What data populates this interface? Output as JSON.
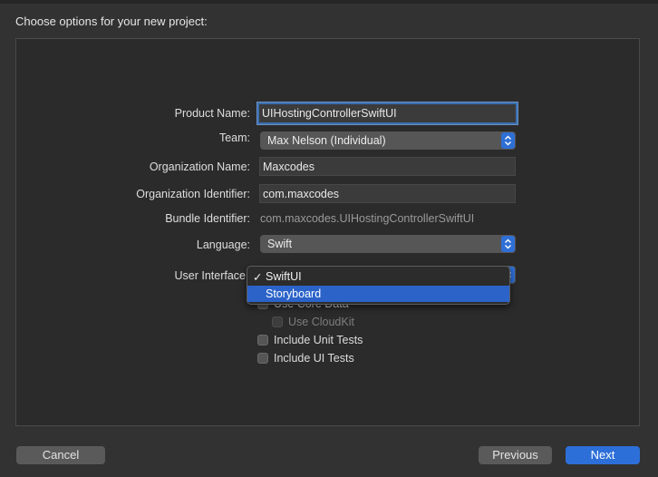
{
  "header": {
    "title": "Choose options for your new project:"
  },
  "form": {
    "product_name": {
      "label": "Product Name:",
      "value": "UIHostingControllerSwiftUI"
    },
    "team": {
      "label": "Team:",
      "value": "Max Nelson (Individual)"
    },
    "organization_name": {
      "label": "Organization Name:",
      "value": "Maxcodes"
    },
    "organization_identifier": {
      "label": "Organization Identifier:",
      "value": "com.maxcodes"
    },
    "bundle_identifier": {
      "label": "Bundle Identifier:",
      "value": "com.maxcodes.UIHostingControllerSwiftUI"
    },
    "language": {
      "label": "Language:",
      "value": "Swift"
    },
    "user_interface": {
      "label": "User Interface",
      "menu": [
        {
          "label": "SwiftUI",
          "checked": true,
          "check_mark": "✓"
        },
        {
          "label": "Storyboard",
          "highlighted": true
        }
      ]
    },
    "checkboxes": [
      {
        "label": "Use Core Data",
        "checked": false
      },
      {
        "label": "Use CloudKit",
        "checked": false,
        "disabled": true
      },
      {
        "label": "Include Unit Tests",
        "checked": false
      },
      {
        "label": "Include UI Tests",
        "checked": false
      }
    ]
  },
  "footer": {
    "cancel_label": "Cancel",
    "previous_label": "Previous",
    "next_label": "Next"
  },
  "colors": {
    "background": "#323232",
    "panel": "#2b2b2b",
    "accent": "#2d6fd8",
    "focus_ring": "#3b6fb0"
  }
}
